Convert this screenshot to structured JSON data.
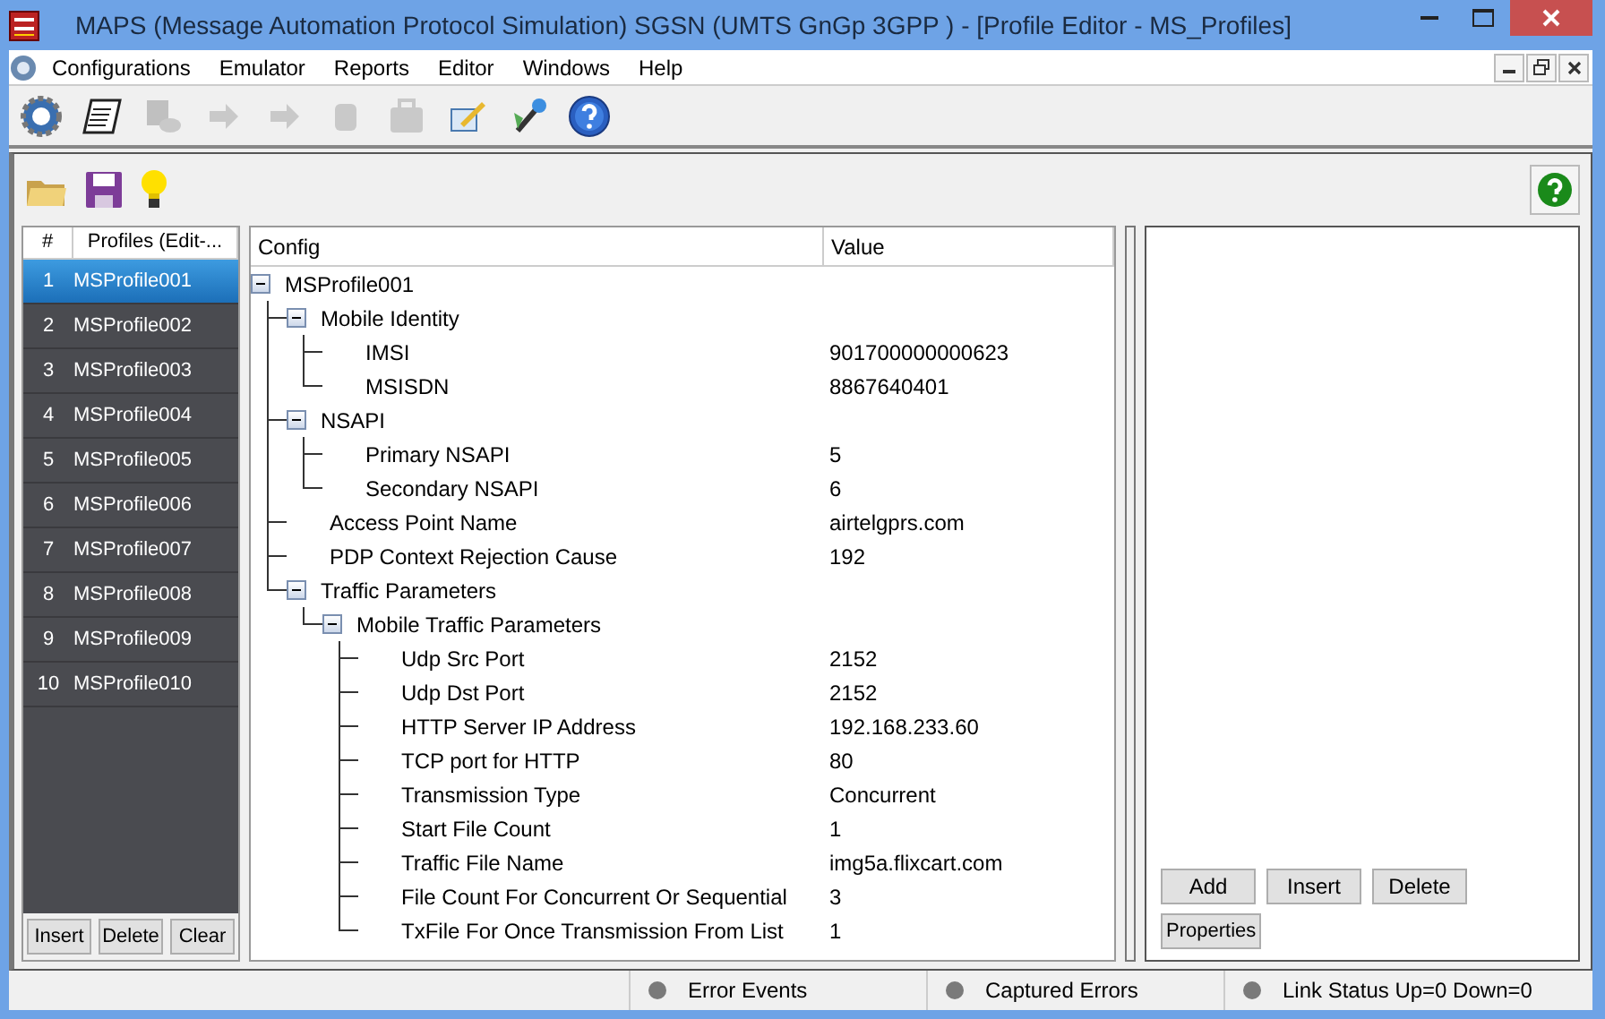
{
  "window": {
    "title": "MAPS (Message Automation Protocol Simulation) SGSN (UMTS GnGp 3GPP ) - [Profile Editor - MS_Profiles]"
  },
  "menu": [
    {
      "label": "Configurations"
    },
    {
      "label": "Emulator"
    },
    {
      "label": "Reports"
    },
    {
      "label": "Editor"
    },
    {
      "label": "Windows"
    },
    {
      "label": "Help"
    }
  ],
  "toolbar": [
    {
      "kind": "gear",
      "disabled": false
    },
    {
      "kind": "document",
      "disabled": false
    },
    {
      "kind": "calls",
      "disabled": true
    },
    {
      "kind": "arrow",
      "disabled": true
    },
    {
      "kind": "arrow",
      "disabled": true
    },
    {
      "kind": "block",
      "disabled": true
    },
    {
      "kind": "case",
      "disabled": true
    },
    {
      "kind": "edit",
      "disabled": false
    },
    {
      "kind": "wand",
      "disabled": false
    },
    {
      "kind": "help",
      "disabled": false
    }
  ],
  "profiles": {
    "columns": [
      "#",
      "Profiles (Edit-..."
    ],
    "rows": [
      {
        "index": "1",
        "name": "MSProfile001",
        "selected": true
      },
      {
        "index": "2",
        "name": "MSProfile002",
        "selected": false
      },
      {
        "index": "3",
        "name": "MSProfile003",
        "selected": false
      },
      {
        "index": "4",
        "name": "MSProfile004",
        "selected": false
      },
      {
        "index": "5",
        "name": "MSProfile005",
        "selected": false
      },
      {
        "index": "6",
        "name": "MSProfile006",
        "selected": false
      },
      {
        "index": "7",
        "name": "MSProfile007",
        "selected": false
      },
      {
        "index": "8",
        "name": "MSProfile008",
        "selected": false
      },
      {
        "index": "9",
        "name": "MSProfile009",
        "selected": false
      },
      {
        "index": "10",
        "name": "MSProfile010",
        "selected": false
      }
    ],
    "buttons": [
      "Insert",
      "Delete",
      "Clear"
    ]
  },
  "config": {
    "columns": [
      "Config",
      "Value"
    ],
    "tree": [
      {
        "label": "MSProfile001",
        "expanded": true,
        "children": [
          {
            "label": "Mobile Identity",
            "expanded": true,
            "children": [
              {
                "label": "IMSI",
                "value": "901700000000623"
              },
              {
                "label": "MSISDN",
                "value": "8867640401"
              }
            ]
          },
          {
            "label": "NSAPI",
            "expanded": true,
            "children": [
              {
                "label": "Primary NSAPI",
                "value": "5"
              },
              {
                "label": "Secondary NSAPI",
                "value": "6"
              }
            ]
          },
          {
            "label": "Access Point Name",
            "value": "airtelgprs.com"
          },
          {
            "label": "PDP Context Rejection Cause",
            "value": "192"
          },
          {
            "label": "Traffic Parameters",
            "expanded": true,
            "children": [
              {
                "label": "Mobile Traffic Parameters",
                "expanded": true,
                "children": [
                  {
                    "label": "Udp Src Port",
                    "value": "2152"
                  },
                  {
                    "label": "Udp Dst Port",
                    "value": "2152"
                  },
                  {
                    "label": "HTTP Server IP Address",
                    "value": "192.168.233.60"
                  },
                  {
                    "label": "TCP port for HTTP",
                    "value": "80"
                  },
                  {
                    "label": "Transmission Type",
                    "value": "Concurrent"
                  },
                  {
                    "label": "Start File Count",
                    "value": "1"
                  },
                  {
                    "label": "Traffic File Name",
                    "value": "img5a.flixcart.com"
                  },
                  {
                    "label": "File Count For Concurrent Or Sequential",
                    "value": "3"
                  },
                  {
                    "label": "TxFile For Once Transmission From List",
                    "value": "1"
                  }
                ]
              }
            ]
          }
        ]
      }
    ]
  },
  "right_panel": {
    "buttons": [
      "Add",
      "Insert",
      "Delete"
    ],
    "properties_button": "Properties"
  },
  "status_bar": [
    {
      "label": "Error Events"
    },
    {
      "label": "Captured Errors"
    },
    {
      "label": "Link Status Up=0 Down=0"
    }
  ]
}
